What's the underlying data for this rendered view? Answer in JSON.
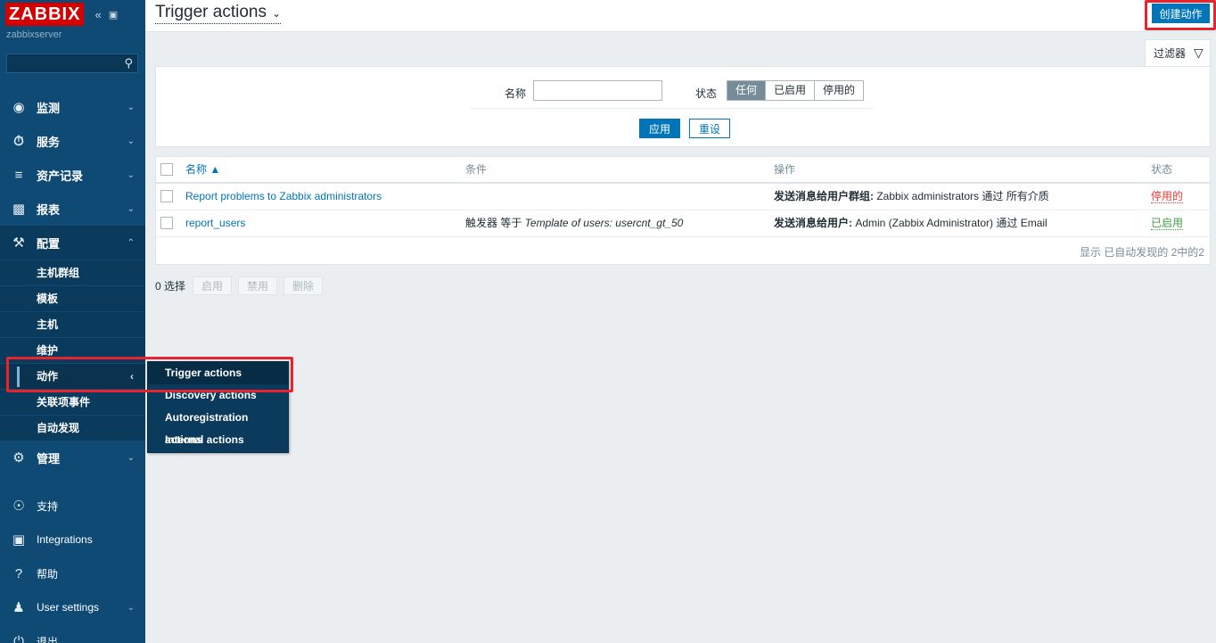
{
  "sidebar": {
    "logo": "ZABBIX",
    "server": "zabbixserver",
    "menu": [
      {
        "label": "监测"
      },
      {
        "label": "服务"
      },
      {
        "label": "资产记录"
      },
      {
        "label": "报表"
      },
      {
        "label": "配置"
      }
    ],
    "config_sub": [
      "主机群组",
      "模板",
      "主机",
      "维护",
      "动作",
      "关联项事件",
      "自动发现"
    ],
    "admin": "管理",
    "bottom": [
      "支持",
      "Integrations",
      "帮助",
      "User settings",
      "退出"
    ]
  },
  "flyout": [
    "Trigger actions",
    "Discovery actions",
    "Autoregistration actions",
    "Internal actions"
  ],
  "header": {
    "title": "Trigger actions",
    "create_button": "创建动作"
  },
  "filter": {
    "tab_label": "过滤器",
    "name_label": "名称",
    "name_value": "",
    "status_label": "状态",
    "status_options": [
      "任何",
      "已启用",
      "停用的"
    ],
    "status_selected": "任何",
    "apply": "应用",
    "reset": "重设"
  },
  "table": {
    "headers": {
      "name": "名称 ▲",
      "conditions": "条件",
      "operations": "操作",
      "status": "状态"
    },
    "rows": [
      {
        "name": "Report problems to Zabbix administrators",
        "condition_prefix": "",
        "condition_italic": "",
        "op_bold": "发送消息给用户群组:",
        "op_rest": " Zabbix administrators 通过 所有介质",
        "status": "停用的"
      },
      {
        "name": "report_users",
        "condition_prefix": "触发器 等于 ",
        "condition_italic": "Template of users: usercnt_gt_50",
        "op_bold": "发送消息给用户:",
        "op_rest": " Admin (Zabbix Administrator) 通过 Email",
        "status": "已启用"
      }
    ],
    "footer": "显示 已自动发现的 2中的2"
  },
  "mass": {
    "selected": "0 选择",
    "buttons": [
      "启用",
      "禁用",
      "删除"
    ]
  },
  "colors": {
    "sidebar": "#0e4a74",
    "accent": "#0275b8",
    "highlight": "#e8232d",
    "disabled": "#e33734",
    "enabled": "#429e47"
  }
}
